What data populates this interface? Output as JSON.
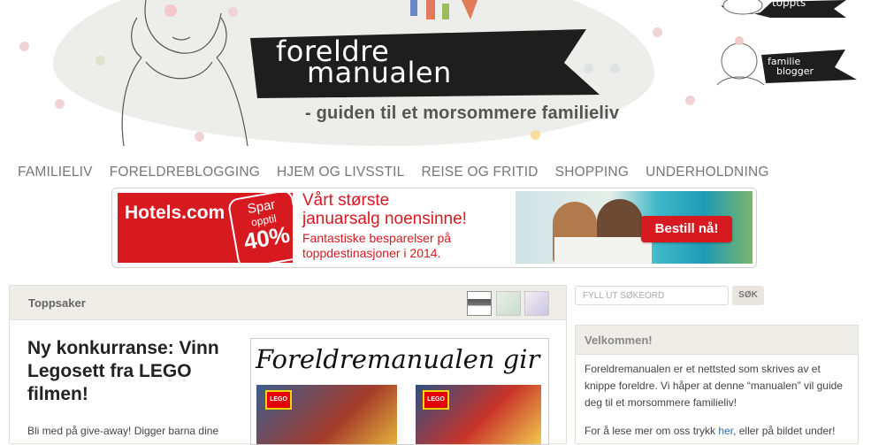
{
  "logo": {
    "line1": "foreldre",
    "line2": "manualen",
    "tagline": "- guiden til et morsommere familieliv"
  },
  "badges": {
    "top": "toppts",
    "blogger_line1": "familie",
    "blogger_line2": "blogger"
  },
  "nav": [
    "FAMILIELIV",
    "FORELDREBLOGGING",
    "HJEM OG LIVSSTIL",
    "REISE OG FRITID",
    "SHOPPING",
    "UNDERHOLDNING"
  ],
  "ad": {
    "brand": "Hotels.com",
    "spar_line1": "Spar",
    "spar_line2": "opptil",
    "spar_line3": "40%",
    "headline1": "Vårt største",
    "headline2": "januarsalg noensinne!",
    "sub1": "Fantastiske besparelser på",
    "sub2": "toppdestinasjoner i 2014.",
    "button": "Bestill nå!"
  },
  "toppsaker": {
    "title": "Toppsaker",
    "article_title": "Ny konkurranse: Vinn Legosett fra LEGO filmen!",
    "article_text": "Bli med på give-away! Digger barna dine",
    "feature_text": "Foreldremanualen gir b"
  },
  "search": {
    "placeholder": "FYLL UT SØKEORD",
    "button": "SØK"
  },
  "welcome": {
    "title": "Velkommen!",
    "p1": "Foreldremanualen er et nettsted som skrives av et knippe foreldre. Vi håper at denne “manualen” vil guide deg til et morsommere familieliv!",
    "p2_before": "For å lese mer om oss trykk ",
    "p2_link": "her",
    "p2_after": ", eller på bildet under!"
  },
  "colors": {
    "accent_red": "#d71920",
    "nav_text": "#777777",
    "panel_bg": "#efede8",
    "link": "#2a6fb0"
  }
}
